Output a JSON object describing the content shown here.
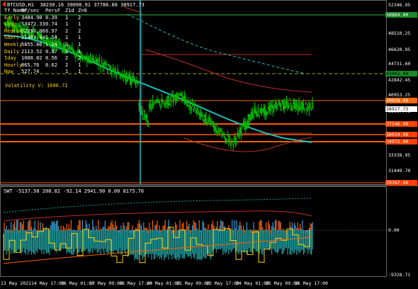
{
  "header": {
    "text": "BTCUSD,H1  38230.16 39098.91 37786.60 38917.73"
  },
  "stats_table": {
    "headers": [
      "Tf Name",
      "RP/sec",
      "PersF",
      "Z1d",
      "Z=0"
    ],
    "rows": [
      [
        "Early",
        "3484.90",
        "0.39",
        "1",
        "2"
      ],
      [
        "Long",
        "53472.33",
        "0.74",
        "1",
        "1"
      ],
      [
        "Medium",
        "32297.06",
        "0.97",
        "2",
        "2"
      ],
      [
        "Short",
        "21483.44",
        "1.54",
        "1",
        "1"
      ],
      [
        "Weekly",
        "5855.86",
        "1.24",
        "2",
        "1"
      ],
      [
        "Daily",
        "2113.52",
        "0.87",
        "1",
        "1"
      ],
      [
        "Iday",
        "1088.82",
        "0.56",
        "2",
        "2"
      ],
      [
        "Hourly",
        "865.76",
        "0.62",
        "2",
        "1"
      ],
      [
        "Now",
        "527.74",
        "",
        "1",
        "1"
      ]
    ]
  },
  "volatility": "Volatility V: 1696.71",
  "price_axis": {
    "labels": [
      "52346.95",
      "50804.00",
      "48510.25",
      "46620.95",
      "44731.60",
      "43402.00",
      "42842.45",
      "40953.25",
      "40026.00",
      "38917.73",
      "37146.00",
      "36024.00",
      "34972.00",
      "33338.95",
      "31449.70",
      "29767.00"
    ]
  },
  "price_tags": [
    {
      "text": "50804.00",
      "color": "#ffffff",
      "bg": "#1a8a2a"
    },
    {
      "text": "43402.00",
      "color": "#000000",
      "bg": "#1a8a2a"
    },
    {
      "text": "40026.00",
      "color": "#ffffff",
      "bg": "#ff6a10"
    },
    {
      "text": "38917.73",
      "color": "#000000",
      "bg": "#ffffff"
    },
    {
      "text": "37146.00",
      "color": "#ffffff",
      "bg": "#ff4000"
    },
    {
      "text": "36024.00",
      "color": "#ffffff",
      "bg": "#ff4000"
    },
    {
      "text": "34972.00",
      "color": "#ffffff",
      "bg": "#ff4000"
    },
    {
      "text": "29767.00",
      "color": "#ffffff",
      "bg": "#ff4000"
    }
  ],
  "sub_window": {
    "title": "SWT -5137.58 208.82 -92.14 2941.90 0.00 8175.76",
    "axis_labels": [
      "0.00",
      "-9328.71"
    ]
  },
  "time_axis": {
    "labels": [
      "13 May 2021",
      "14 May 17:00",
      "16 May 01:00",
      "17 May 09:00",
      "18 May 17:00",
      "20 May 01:00",
      "21 May 09:00",
      "22 May 17:00",
      "24 May 01:00",
      "25 May 09:00",
      "26 May 17:00"
    ]
  },
  "colors": {
    "background": "#000000",
    "candles": "#00c000",
    "ma_cyan": "#20c0c0",
    "level_orange": "#ff5a00",
    "level_green": "#38c038",
    "histogram_orange": "#ff6000",
    "histogram_blue": "#30a0e0",
    "histogram_teal": "#20a0a0",
    "signal_yellow": "#ffd000"
  }
}
